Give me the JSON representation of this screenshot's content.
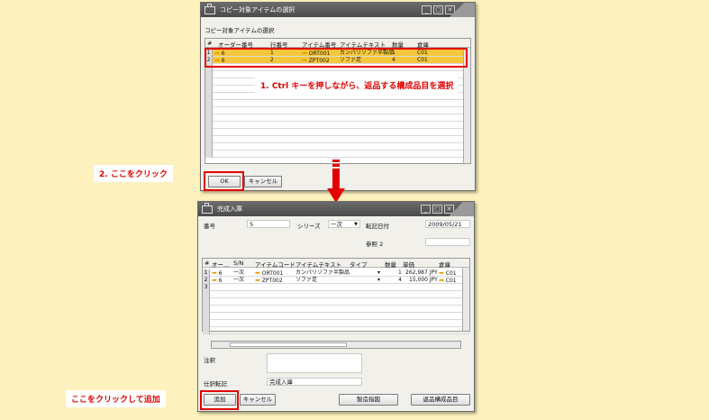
{
  "top_window": {
    "title": "コピー対象アイテムの選択",
    "subtitle": "コピー対象アイテムの選択",
    "columns": [
      "#",
      "オーダー番号",
      "行番号",
      "アイテム番号",
      "アイテムテキスト",
      "数量",
      "倉庫"
    ],
    "rows": [
      {
        "num": "1",
        "order": "6",
        "line": "1",
        "item": "ORT001",
        "text": "カンパリソファ半製品",
        "qty": "1",
        "wh": "C01"
      },
      {
        "num": "2",
        "order": "6",
        "line": "2",
        "item": "ZPT002",
        "text": "ソファ足",
        "qty": "4",
        "wh": "C01"
      }
    ],
    "ok_label": "OK",
    "cancel_label": "キャンセル"
  },
  "bottom_window": {
    "title": "完成入庫",
    "number_label": "番号",
    "number_value": "5",
    "series_label": "シリーズ",
    "series_value": "一次",
    "date_label": "転記日付",
    "date_value": "2009/05/21",
    "ref2_label": "参照 2",
    "columns": [
      "#",
      "オー...",
      "S/N",
      "アイテムコード",
      "アイテムテキスト",
      "タイプ",
      "数量",
      "単価",
      "倉庫"
    ],
    "rows": [
      {
        "num": "1",
        "order": "6",
        "sn": "一次",
        "code": "ORT001",
        "text": "カンパリソファ半製品",
        "type": "",
        "qty": "1",
        "price": "262,987 JPY",
        "wh": "C01"
      },
      {
        "num": "2",
        "order": "6",
        "sn": "一次",
        "code": "ZPT002",
        "text": "ソファ足",
        "type": "",
        "qty": "4",
        "price": "15,000 JPY",
        "wh": "C01"
      },
      {
        "num": "3",
        "order": "",
        "sn": "",
        "code": "",
        "text": "",
        "type": "",
        "qty": "",
        "price": "",
        "wh": ""
      }
    ],
    "remarks_label": "注釈",
    "journal_label": "仕訳転記",
    "journal_value": "完成入庫",
    "add_label": "追加",
    "cancel_label": "キャンセル",
    "copy_from_label": "製造指図",
    "return_label": "返品構成品目"
  },
  "callouts": {
    "step1": "1. Ctrl キーを押しながら、返品する構成品目を選択",
    "step2": "2. ここをクリック",
    "step3": "ここをクリックして追加"
  },
  "colors": {
    "highlight": "#f6c73a",
    "annotation": "#e30000",
    "background": "#fdf1bd"
  }
}
